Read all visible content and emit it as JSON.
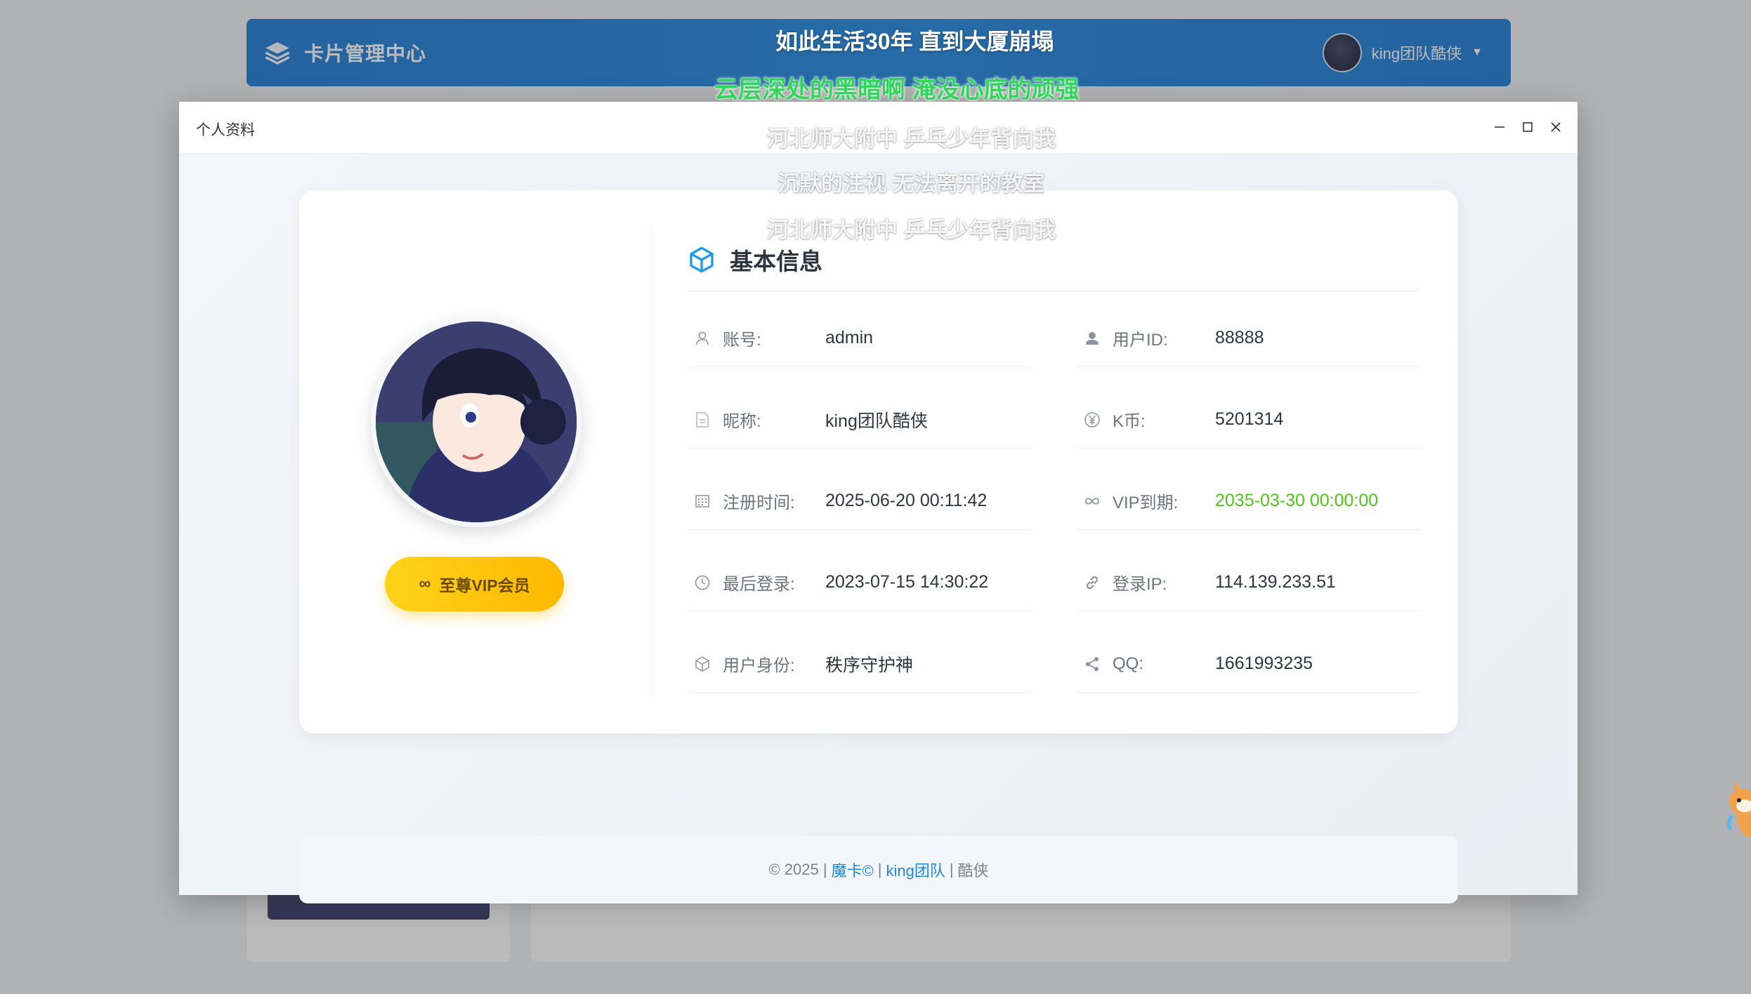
{
  "app": {
    "brand": "卡片管理中心",
    "user_name": "king团队酷侠"
  },
  "modal": {
    "title": "个人资料",
    "controls": {
      "minimize": "—",
      "maximize": "☐",
      "close": "✕"
    }
  },
  "profile": {
    "vip_badge": "至尊VIP会员",
    "section_title": "基本信息",
    "fields": [
      {
        "icon": "user-outline-icon",
        "label": "账号:",
        "value": "admin"
      },
      {
        "icon": "user-solid-icon",
        "label": "用户ID:",
        "value": "88888"
      },
      {
        "icon": "document-icon",
        "label": "昵称:",
        "value": "king团队酷侠"
      },
      {
        "icon": "yen-icon",
        "label": "K币:",
        "value": "5201314"
      },
      {
        "icon": "calendar-icon",
        "label": "注册时间:",
        "value": "2025-06-20 00:11:42"
      },
      {
        "icon": "infinity-icon",
        "label": "VIP到期:",
        "value": "2035-03-30 00:00:00",
        "color": "#52c41a"
      },
      {
        "icon": "clock-icon",
        "label": "最后登录:",
        "value": "2023-07-15 14:30:22"
      },
      {
        "icon": "link-icon",
        "label": "登录IP:",
        "value": "114.139.233.51"
      },
      {
        "icon": "cube-icon",
        "label": "用户身份:",
        "value": "秩序守护神"
      },
      {
        "icon": "share-icon",
        "label": "QQ:",
        "value": "1661993235"
      }
    ]
  },
  "footer": {
    "copyright": "© 2025 |",
    "link1": "魔卡©",
    "sep1": "|",
    "link2": "king团队",
    "sep2": "|",
    "tail": "酷侠"
  },
  "lyrics": [
    "如此生活30年 直到大厦崩塌",
    "云层深处的黑暗啊 淹没心底的顽强",
    "河北师大附中 乒乓少年背向我",
    "沉默的注视 无法离开的教室",
    "河北师大附中 乒乓少年背向我"
  ],
  "colors": {
    "header_blue": "#1a78d6",
    "accent_blue": "#1e88e5",
    "vip_gold": "#ffc107",
    "vip_green": "#52c41a",
    "lyric_green": "#2fd65a"
  }
}
